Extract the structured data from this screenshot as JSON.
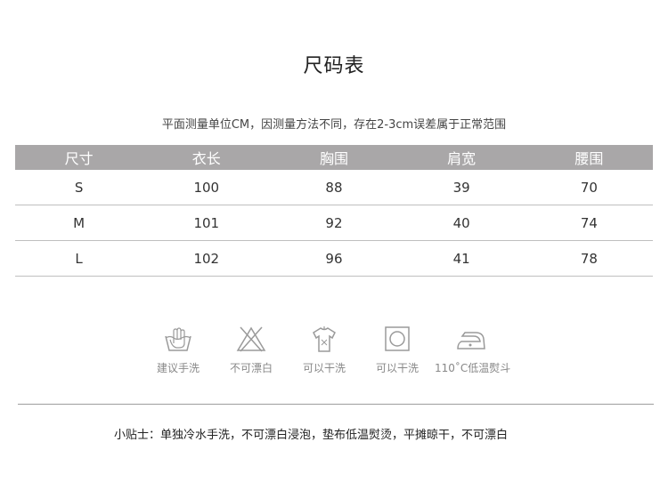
{
  "title": "尺码表",
  "subtitle": "平面测量单位CM，因测量方法不同，存在2-3cm误差属于正常范围",
  "table": {
    "headers": [
      "尺寸",
      "衣长",
      "胸围",
      "肩宽",
      "腰围"
    ],
    "rows": [
      [
        "S",
        "100",
        "88",
        "39",
        "70"
      ],
      [
        "M",
        "101",
        "92",
        "40",
        "74"
      ],
      [
        "L",
        "102",
        "96",
        "41",
        "78"
      ]
    ]
  },
  "care": [
    {
      "icon": "hand-wash-icon",
      "label": "建议手洗"
    },
    {
      "icon": "no-bleach-icon",
      "label": "不可漂白"
    },
    {
      "icon": "hang-dry-icon",
      "label": "可以干洗"
    },
    {
      "icon": "tumble-dry-icon",
      "label": "可以干洗"
    },
    {
      "icon": "iron-icon",
      "label": "110˚C低温熨斗"
    }
  ],
  "tip": "小贴士：单独冷水手洗，不可漂白浸泡，垫布低温熨烫，平摊晾干，不可漂白"
}
